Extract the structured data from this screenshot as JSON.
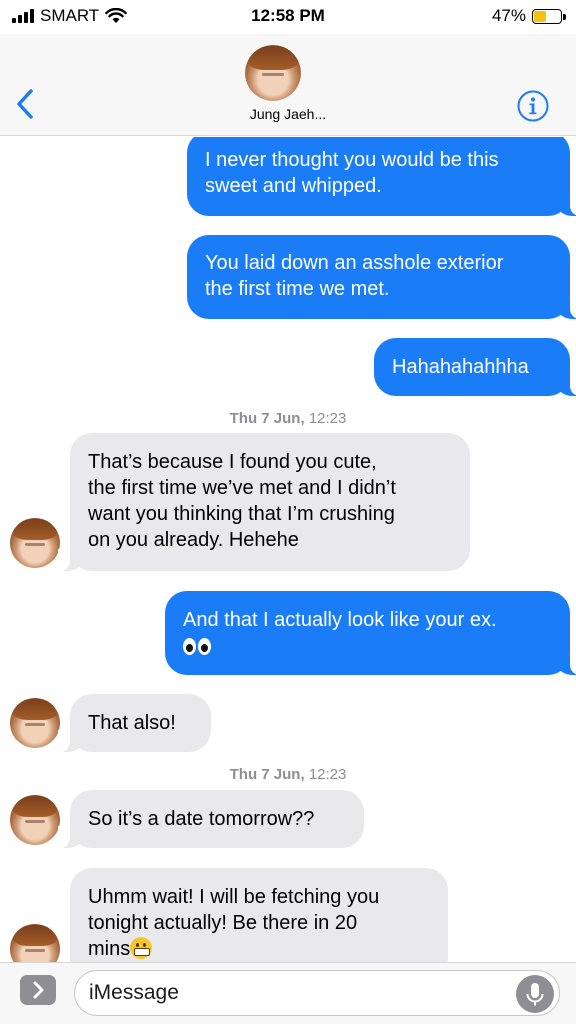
{
  "status_bar": {
    "carrier": "SMART",
    "time": "12:58 PM",
    "battery_percent": "47%",
    "battery_level": 0.47,
    "battery_color": "#f5c10d"
  },
  "header": {
    "contact_name": "Jung Jaeh...",
    "back_icon": "chevron-left-icon",
    "info_icon": "info-icon",
    "accent_color": "#1a7df7"
  },
  "messages": [
    {
      "direction": "sent",
      "lines": [
        "I never thought you would be this",
        "sweet and whipped."
      ]
    },
    {
      "direction": "sent",
      "lines": [
        "You laid down an asshole exterior",
        "the first time we met."
      ]
    },
    {
      "direction": "sent",
      "lines": [
        "Hahahahahhha"
      ]
    },
    {
      "type": "timestamp",
      "day": "Thu 7 Jun,",
      "time": "12:23"
    },
    {
      "direction": "received",
      "lines": [
        "That’s because I found you cute,",
        "the first time we’ve met and I didn’t",
        "want you thinking that I’m crushing",
        "on you already. Hehehe"
      ]
    },
    {
      "direction": "sent",
      "lines": [
        "And that I actually look like your ex."
      ],
      "emoji": "eyes-emoji-icon"
    },
    {
      "direction": "received",
      "lines": [
        "That also!"
      ]
    },
    {
      "type": "timestamp",
      "day": "Thu 7 Jun,",
      "time": "12:23"
    },
    {
      "direction": "received",
      "lines": [
        "So it’s a date tomorrow??"
      ]
    },
    {
      "direction": "received",
      "lines": [
        "Uhmm wait! I will be fetching you",
        "tonight actually! Be there in 20",
        "mins"
      ],
      "emoji": "grimacing-face-emoji-icon"
    }
  ],
  "input_bar": {
    "placeholder": "iMessage",
    "apps_icon": "chevron-right-icon",
    "mic_icon": "microphone-icon"
  },
  "colors": {
    "sent_bubble": "#1a7df7",
    "received_bubble": "#e9e9eb",
    "timestamp_text": "#8e8e93"
  }
}
